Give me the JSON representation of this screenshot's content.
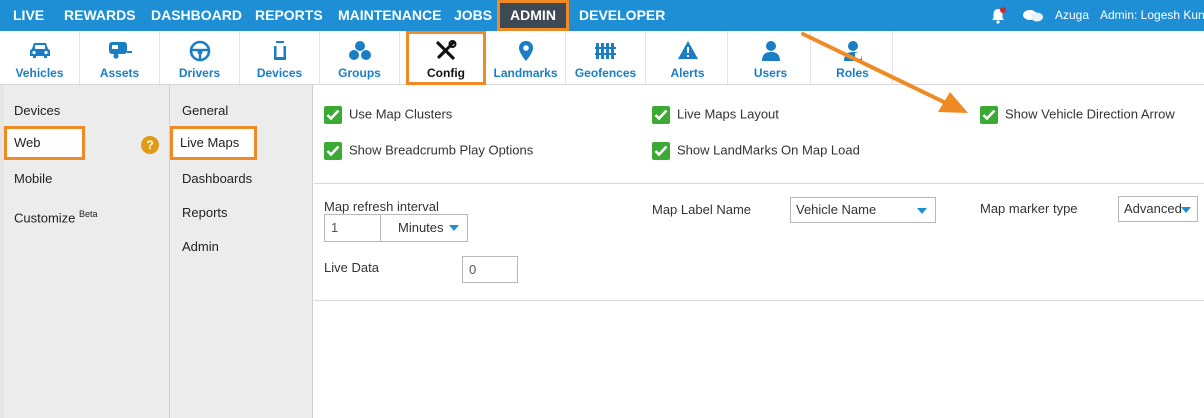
{
  "topnav": {
    "items": [
      {
        "label": "LIVE",
        "icon": "",
        "active": false
      },
      {
        "label": "REWARDS",
        "active": false
      },
      {
        "label": "DASHBOARD",
        "active": false
      },
      {
        "label": "REPORTS",
        "active": false
      },
      {
        "label": "MAINTENANCE",
        "active": false
      },
      {
        "label": "JOBS",
        "active": false
      },
      {
        "label": "ADMIN",
        "active": true
      },
      {
        "label": "DEVELOPER",
        "active": false
      }
    ],
    "icons": [
      "bell-icon",
      "chat-icon"
    ],
    "brand": "Azuga",
    "user": "Admin: Logesh Kun"
  },
  "toolbar": {
    "items": [
      {
        "label": "Vehicles",
        "icon": "car-icon"
      },
      {
        "label": "Assets",
        "icon": "trailer-icon"
      },
      {
        "label": "Drivers",
        "icon": "steering-wheel-icon"
      },
      {
        "label": "Devices",
        "icon": "device-icon"
      },
      {
        "label": "Groups",
        "icon": "groups-icon"
      },
      {
        "label": "Config",
        "icon": "tools-icon",
        "active": true
      },
      {
        "label": "Landmarks",
        "icon": "map-pin-icon"
      },
      {
        "label": "Geofences",
        "icon": "fence-icon"
      },
      {
        "label": "Alerts",
        "icon": "alert-icon"
      },
      {
        "label": "Users",
        "icon": "user-icon"
      },
      {
        "label": "Roles",
        "icon": "roles-icon"
      }
    ]
  },
  "sidebar1": {
    "items": [
      {
        "label": "Devices"
      },
      {
        "label": "Web",
        "selected": true,
        "help": "?"
      },
      {
        "label": "Mobile"
      },
      {
        "label": "Customize",
        "sup": "Beta"
      }
    ]
  },
  "sidebar2": {
    "items": [
      {
        "label": "General"
      },
      {
        "label": "Live Maps",
        "selected": true
      },
      {
        "label": "Dashboards"
      },
      {
        "label": "Reports"
      },
      {
        "label": "Admin"
      }
    ]
  },
  "settings": {
    "checkboxes": [
      {
        "label": "Use Map Clusters",
        "checked": true
      },
      {
        "label": "Live Maps Layout",
        "checked": true
      },
      {
        "label": "Show Vehicle Direction Arrow",
        "checked": true
      },
      {
        "label": "Show Breadcrumb Play Options",
        "checked": true
      },
      {
        "label": "Show LandMarks On Map Load",
        "checked": true
      }
    ],
    "refresh": {
      "label": "Map refresh interval",
      "value": "1",
      "unit": "Minutes"
    },
    "map_label": {
      "label": "Map Label Name",
      "value": "Vehicle Name"
    },
    "marker": {
      "label": "Map marker type",
      "value": "Advanced"
    },
    "live_data": {
      "label": "Live Data",
      "value": "0"
    }
  },
  "colors": {
    "nav": "#1e8fd5",
    "accent": "#f08a24",
    "check": "#3aaa35",
    "icon": "#1a7ec4"
  }
}
